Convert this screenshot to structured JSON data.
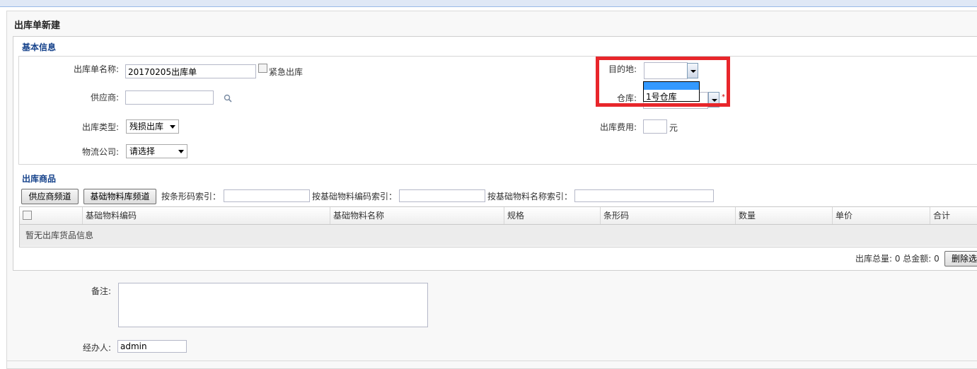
{
  "page": {
    "title": "出库单新建"
  },
  "basic": {
    "section_title": "基本信息",
    "name_label": "出库单名称:",
    "name_value": "20170205出库单",
    "urgent_label": "紧急出库",
    "supplier_label": "供应商:",
    "type_label": "出库类型:",
    "type_value": "残损出库",
    "logistics_label": "物流公司:",
    "logistics_value": "请选择",
    "dest_label": "目的地:",
    "dest_option": "1号仓库",
    "warehouse_label": "仓库:",
    "required_mark": "*",
    "fee_label": "出库费用:",
    "fee_unit": "元"
  },
  "goods": {
    "section_title": "出库商品",
    "supplier_channel_btn": "供应商频道",
    "material_channel_btn": "基础物料库频道",
    "barcode_index_label": "按条形码索引：",
    "code_index_label": "按基础物料编码索引：",
    "name_index_label": "按基础物料名称索引：",
    "columns": [
      "基础物料编码",
      "基础物料名称",
      "规格",
      "条形码",
      "数量",
      "单价",
      "合计"
    ],
    "empty_text": "暂无出库货品信息",
    "summary": "出库总量: 0 总金额: 0",
    "delete_btn": "删除选"
  },
  "footer": {
    "remark_label": "备注:",
    "handler_label": "经办人:",
    "handler_value": "admin"
  },
  "colors": {
    "highlight": "#e8262b",
    "section_title": "#15428b",
    "selected_option": "#3399ff"
  }
}
